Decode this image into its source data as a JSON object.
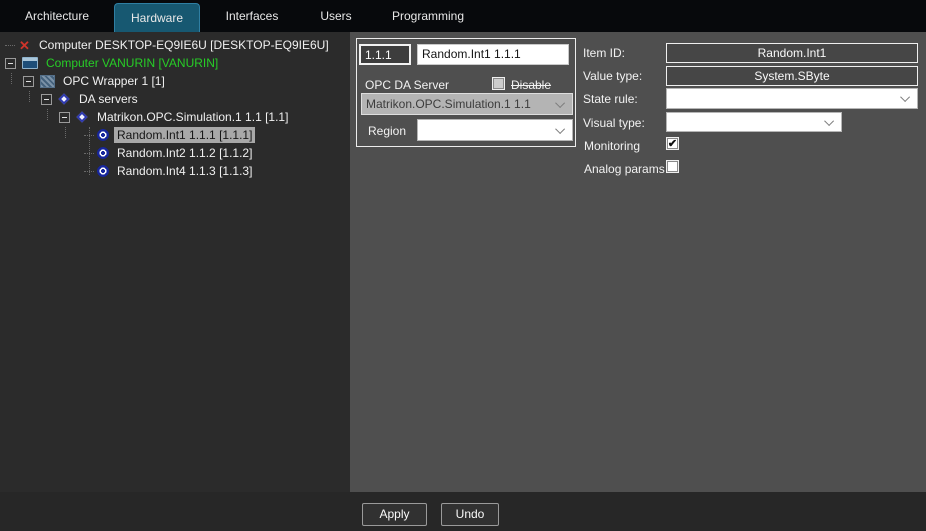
{
  "tabs": {
    "items": [
      {
        "label": "Architecture",
        "selected": false
      },
      {
        "label": "Hardware",
        "selected": true
      },
      {
        "label": "Interfaces",
        "selected": false
      },
      {
        "label": "Users",
        "selected": false
      },
      {
        "label": "Programming",
        "selected": false
      }
    ]
  },
  "tree": {
    "items": [
      {
        "label": "Computer DESKTOP-EQ9IE6U [DESKTOP-EQ9IE6U]",
        "icon": "error-x",
        "state": "error"
      },
      {
        "label": "Computer VANURIN [VANURIN]",
        "icon": "computer-monitor",
        "state": "online"
      },
      {
        "label": "OPC Wrapper 1 [1]",
        "icon": "opc-wrapper"
      },
      {
        "label": "DA servers",
        "icon": "diamond"
      },
      {
        "label": "Matrikon.OPC.Simulation.1 1.1 [1.1]",
        "icon": "diamond"
      },
      {
        "label": "Random.Int1 1.1.1 [1.1.1]",
        "icon": "tag-bullseye",
        "selected": true
      },
      {
        "label": "Random.Int2 1.1.2 [1.1.2]",
        "icon": "tag-bullseye"
      },
      {
        "label": "Random.Int4 1.1.3 [1.1.3]",
        "icon": "tag-bullseye"
      }
    ]
  },
  "editor": {
    "code_field": "1.1.1",
    "name_field": "Random.Int1 1.1.1",
    "opc_da_server_label": "OPC DA Server",
    "disable_label": "Disable",
    "disable_checked": false,
    "server_dropdown_value": "Matrikon.OPC.Simulation.1 1.1",
    "region_label": "Region",
    "region_dropdown_value": ""
  },
  "properties": {
    "item_id_label": "Item ID:",
    "item_id_value": "Random.Int1",
    "value_type_label": "Value type:",
    "value_type_value": "System.SByte",
    "state_rule_label": "State rule:",
    "state_rule_value": "",
    "visual_type_label": "Visual type:",
    "visual_type_value": "",
    "monitoring_label": "Monitoring",
    "monitoring_checked": true,
    "analog_params_label": "Analog params",
    "analog_params_checked": false
  },
  "actions": {
    "apply_label": "Apply",
    "undo_label": "Undo"
  },
  "colors": {
    "selected_tab": "#175871",
    "online_computer_green": "#27cd27",
    "error_red": "#cf342a",
    "panel_gray": "#4f4f4f",
    "tree_background": "#2b2b2b",
    "selected_row": "#a8a8a8"
  }
}
